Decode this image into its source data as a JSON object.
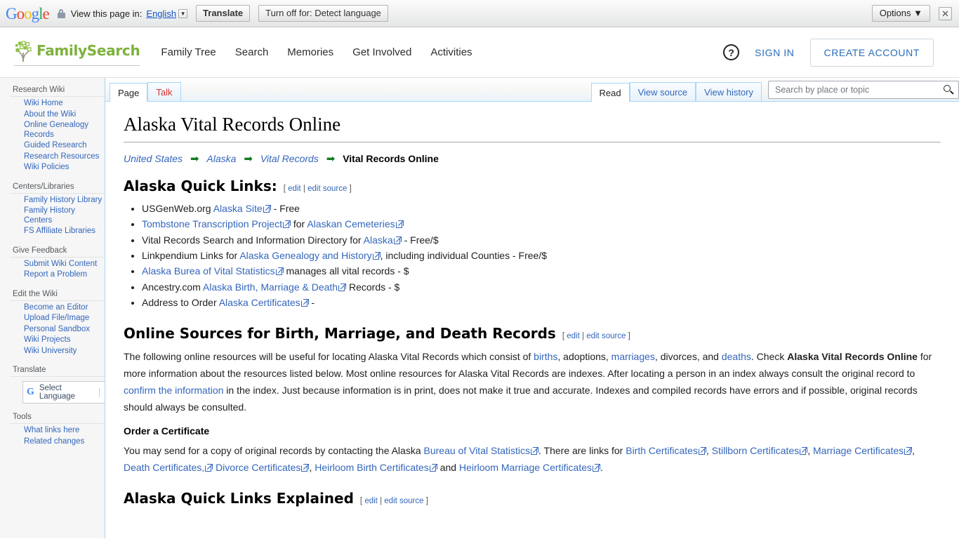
{
  "translate_bar": {
    "logo": "Google",
    "lock_icon": "lock-icon",
    "view_text": "View this page in:",
    "language": "English",
    "translate_button": "Translate",
    "turn_off_button": "Turn off for: Detect language",
    "options_button": "Options ▼",
    "close_icon": "✕"
  },
  "header": {
    "logo_text": "FamilySearch",
    "nav": [
      {
        "label": "Family Tree"
      },
      {
        "label": "Search"
      },
      {
        "label": "Memories"
      },
      {
        "label": "Get Involved"
      },
      {
        "label": "Activities"
      }
    ],
    "help_icon": "?",
    "sign_in": "SIGN IN",
    "create_account": "CREATE ACCOUNT"
  },
  "sidebar": {
    "groups": [
      {
        "title": "Research Wiki",
        "items": [
          "Wiki Home",
          "About the Wiki",
          "Online Genealogy Records",
          "Guided Research",
          "Research Resources",
          "Wiki Policies"
        ]
      },
      {
        "title": "Centers/Libraries",
        "items": [
          "Family History Library",
          "Family History Centers",
          "FS Affiliate Libraries"
        ]
      },
      {
        "title": "Give Feedback",
        "items": [
          "Submit Wiki Content",
          "Report a Problem"
        ]
      },
      {
        "title": "Edit the Wiki",
        "items": [
          "Become an Editor",
          "Upload File/Image",
          "Personal Sandbox",
          "Wiki Projects",
          "Wiki University"
        ]
      }
    ],
    "translate_title": "Translate",
    "select_language": "Select Language",
    "tools_title": "Tools",
    "tools_items": [
      "What links here",
      "Related changes"
    ]
  },
  "tabs": {
    "left": [
      {
        "label": "Page",
        "state": "selected"
      },
      {
        "label": "Talk",
        "state": "new"
      }
    ],
    "right": [
      {
        "label": "Read",
        "state": "selected"
      },
      {
        "label": "View source",
        "state": "normal"
      },
      {
        "label": "View history",
        "state": "normal"
      }
    ]
  },
  "search": {
    "placeholder": "Search by place or topic",
    "value": "",
    "icon": "search-icon"
  },
  "article": {
    "title": "Alaska Vital Records Online",
    "breadcrumb": {
      "links": [
        "United States",
        "Alaska",
        "Vital Records"
      ],
      "arrow": "➡",
      "current": "Vital Records Online"
    },
    "edit_links": {
      "open": "[",
      "edit": "edit",
      "sep": "|",
      "edit_source": "edit source",
      "close": "]"
    },
    "quick_links_heading": "Alaska Quick Links:",
    "quick_links": [
      {
        "parts": [
          {
            "t": "text",
            "v": "USGenWeb.org "
          },
          {
            "t": "link",
            "v": "Alaska Site",
            "ext": true
          },
          {
            "t": "text",
            "v": " - Free"
          }
        ]
      },
      {
        "parts": [
          {
            "t": "link",
            "v": "Tombstone Transcription Project",
            "ext": true
          },
          {
            "t": "text",
            "v": " for "
          },
          {
            "t": "link",
            "v": "Alaskan Cemeteries",
            "ext": true
          }
        ]
      },
      {
        "parts": [
          {
            "t": "text",
            "v": "Vital Records Search and Information Directory for "
          },
          {
            "t": "link",
            "v": "Alaska",
            "ext": true
          },
          {
            "t": "text",
            "v": " - Free/$"
          }
        ]
      },
      {
        "parts": [
          {
            "t": "text",
            "v": "Linkpendium Links for "
          },
          {
            "t": "link",
            "v": "Alaska Genealogy and History",
            "ext": true
          },
          {
            "t": "text",
            "v": ", including individual Counties - Free/$"
          }
        ]
      },
      {
        "parts": [
          {
            "t": "link",
            "v": "Alaska Burea of Vital Statistics",
            "ext": true
          },
          {
            "t": "text",
            "v": " manages all vital records - $"
          }
        ]
      },
      {
        "parts": [
          {
            "t": "text",
            "v": "Ancestry.com "
          },
          {
            "t": "link",
            "v": "Alaska Birth, Marriage & Death",
            "ext": true
          },
          {
            "t": "text",
            "v": " Records - $"
          }
        ]
      },
      {
        "parts": [
          {
            "t": "text",
            "v": "Address to Order "
          },
          {
            "t": "link",
            "v": "Alaska Certificates",
            "ext": true
          },
          {
            "t": "text",
            "v": " -"
          }
        ]
      }
    ],
    "online_sources_heading": "Online Sources for Birth, Marriage, and Death Records",
    "online_sources_paragraph": [
      {
        "t": "text",
        "v": "The following online resources will be useful for locating Alaska Vital Records which consist of "
      },
      {
        "t": "link",
        "v": "births"
      },
      {
        "t": "text",
        "v": ", adoptions, "
      },
      {
        "t": "link",
        "v": "marriages"
      },
      {
        "t": "text",
        "v": ", divorces, and "
      },
      {
        "t": "link",
        "v": "deaths"
      },
      {
        "t": "text",
        "v": ". Check "
      },
      {
        "t": "bold",
        "v": "Alaska Vital Records Online"
      },
      {
        "t": "text",
        "v": " for more information about the resources listed below. Most online resources for Alaska Vital Records are indexes. After locating a person in an index always consult the original record to "
      },
      {
        "t": "link",
        "v": "confirm the information"
      },
      {
        "t": "text",
        "v": " in the index. Just because information is in print, does not make it true and accurate. Indexes and compiled records have errors and if possible, original records should always be consulted."
      }
    ],
    "order_certificate_heading": "Order a Certificate",
    "order_certificate_paragraph": [
      {
        "t": "text",
        "v": "You may send for a copy of original records by contacting the Alaska "
      },
      {
        "t": "link",
        "v": "Bureau of Vital Statistics",
        "ext": true
      },
      {
        "t": "text",
        "v": ". There are links for "
      },
      {
        "t": "link",
        "v": "Birth Certificates",
        "ext": true
      },
      {
        "t": "text",
        "v": ", "
      },
      {
        "t": "link",
        "v": "Stillborn Certificates",
        "ext": true
      },
      {
        "t": "text",
        "v": ", "
      },
      {
        "t": "link",
        "v": "Marriage Certificates",
        "ext": true
      },
      {
        "t": "text",
        "v": ", "
      },
      {
        "t": "link",
        "v": "Death Certificates,",
        "ext": true
      },
      {
        "t": "text",
        "v": " "
      },
      {
        "t": "link",
        "v": "Divorce Certificates",
        "ext": true
      },
      {
        "t": "text",
        "v": ", "
      },
      {
        "t": "link",
        "v": "Heirloom Birth Certificates",
        "ext": true
      },
      {
        "t": "text",
        "v": " and "
      },
      {
        "t": "link",
        "v": "Heirloom Marriage Certificates",
        "ext": true
      },
      {
        "t": "text",
        "v": "."
      }
    ],
    "explained_heading": "Alaska Quick Links Explained"
  },
  "colors": {
    "brand_green": "#7eb13c",
    "link_blue": "#3366bb",
    "accent_blue": "#2a6ebb",
    "arrow_green": "#127a1f",
    "tab_border": "#a7d7f9"
  }
}
